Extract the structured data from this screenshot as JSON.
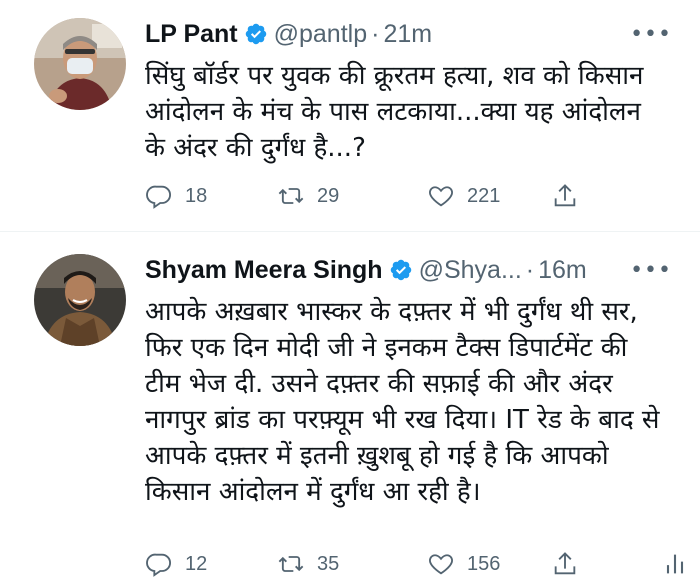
{
  "tweets": [
    {
      "name": "LP Pant",
      "handle": "@pantlp",
      "separator": "·",
      "time": "21m",
      "more": "•••",
      "text": "सिंघु बॉर्डर पर युवक की क्रूरतम हत्या, शव को किसान\nआंदोलन के मंच के पास लटकाया...क्या यह आंदोलन\nके अंदर की दुर्गंध है...?",
      "replies": "18",
      "retweets": "29",
      "likes": "221",
      "verified_icon": "verified-badge-icon"
    },
    {
      "name": "Shyam Meera Singh",
      "handle": "@Shya...",
      "separator": "·",
      "time": "16m",
      "more": "•••",
      "text": "आपके अख़बार भास्कर के दफ़्तर में भी दुर्गंध थी सर,\nफिर एक दिन मोदी जी ने इनकम टैक्स डिपार्टमेंट की\nटीम भेज दी. उसने दफ़्तर की सफ़ाई की और अंदर\nनागपुर ब्रांड का परफ़्यूम भी रख दिया। IT रेड के बाद से\nआपके दफ़्तर में इतनी ख़ुशबू हो गई है कि आपको\nकिसान आंदोलन में दुर्गंध आ रही है।",
      "replies": "12",
      "retweets": "35",
      "likes": "156",
      "verified_icon": "verified-badge-icon"
    }
  ],
  "colors": {
    "text": "#0f1419",
    "secondary": "#536471",
    "verified": "#1d9bf0",
    "divider": "#eff3f4"
  }
}
